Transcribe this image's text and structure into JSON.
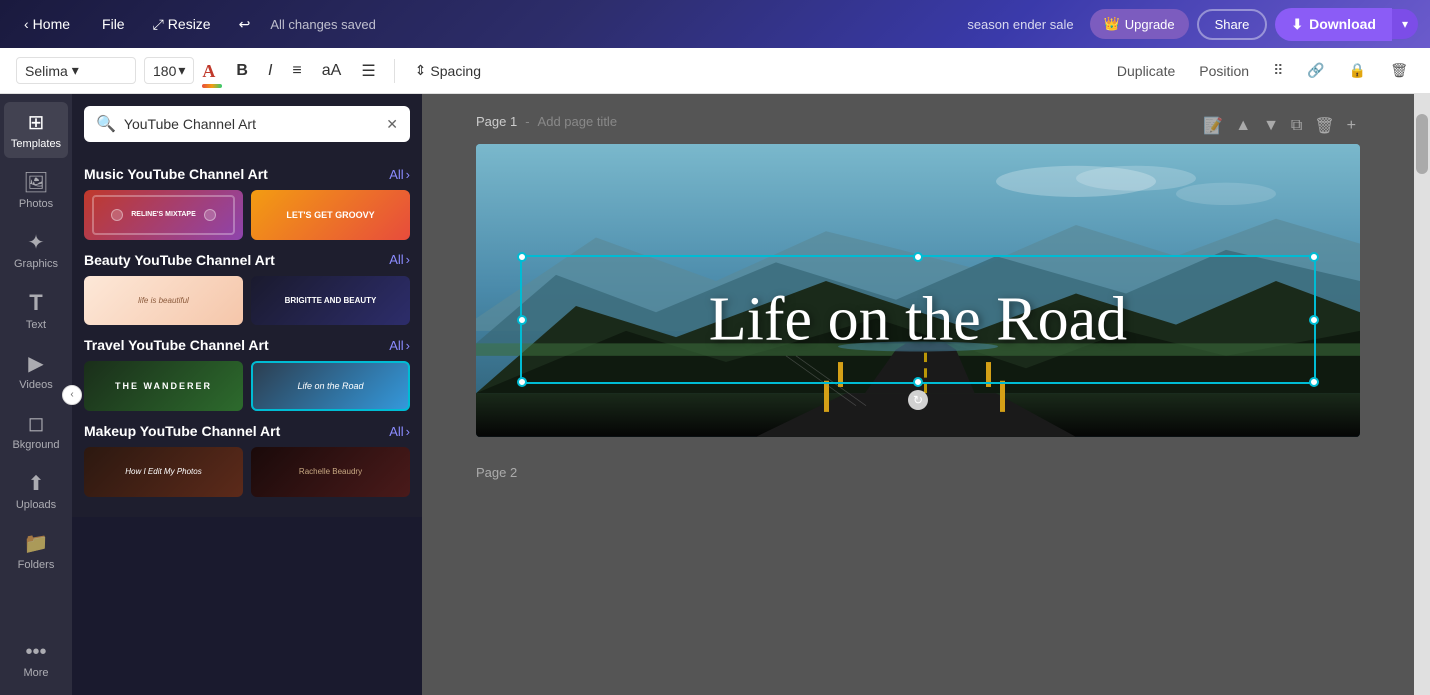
{
  "topnav": {
    "home_label": "Home",
    "file_label": "File",
    "resize_label": "Resize",
    "undo_icon": "↩",
    "changes_saved": "All changes saved",
    "sale_text": "season ender sale",
    "upgrade_label": "Upgrade",
    "upgrade_icon": "👑",
    "share_label": "Share",
    "download_label": "Download",
    "download_icon": "⬇"
  },
  "toolbar": {
    "font_name": "Selima",
    "font_size": "180",
    "bold_label": "B",
    "italic_label": "I",
    "align_icon": "≡",
    "case_icon": "aA",
    "spacing_label": "Spacing",
    "duplicate_label": "Duplicate",
    "position_label": "Position",
    "link_icon": "🔗",
    "lock_icon": "🔒",
    "trash_icon": "🗑"
  },
  "sidebar": {
    "items": [
      {
        "id": "templates",
        "label": "Templates",
        "icon": "⊞"
      },
      {
        "id": "photos",
        "label": "Photos",
        "icon": "🖼"
      },
      {
        "id": "graphics",
        "label": "Graphics",
        "icon": "✦"
      },
      {
        "id": "text",
        "label": "Text",
        "icon": "T"
      },
      {
        "id": "videos",
        "label": "Videos",
        "icon": "▶"
      },
      {
        "id": "background",
        "label": "Bkground",
        "icon": "◻"
      },
      {
        "id": "uploads",
        "label": "Uploads",
        "icon": "⬆"
      },
      {
        "id": "folders",
        "label": "Folders",
        "icon": "📁"
      },
      {
        "id": "more",
        "label": "More",
        "icon": "•••"
      }
    ]
  },
  "panel": {
    "search_value": "YouTube Channel Art",
    "search_placeholder": "YouTube Channel Art",
    "sections": [
      {
        "id": "music",
        "title": "Music YouTube Channel Art",
        "all_label": "All",
        "templates": [
          {
            "id": "music-1",
            "style": "tmpl-music-1",
            "text": "RELINE'S MIXTAPE"
          },
          {
            "id": "music-2",
            "style": "tmpl-music-2",
            "text": "LET'S GET GROOVY"
          }
        ]
      },
      {
        "id": "beauty",
        "title": "Beauty YouTube Channel Art",
        "all_label": "All",
        "templates": [
          {
            "id": "beauty-1",
            "style": "tmpl-beauty-1",
            "text": ""
          },
          {
            "id": "beauty-2",
            "style": "tmpl-beauty-2",
            "text": "BRIGITTE AND BEAUTY"
          }
        ]
      },
      {
        "id": "travel",
        "title": "Travel YouTube Channel Art",
        "all_label": "All",
        "templates": [
          {
            "id": "travel-1",
            "style": "tmpl-travel-1",
            "text": "THE WANDERER"
          },
          {
            "id": "travel-2",
            "style": "tmpl-travel-2",
            "text": "Life on the Road"
          }
        ]
      },
      {
        "id": "makeup",
        "title": "Makeup YouTube Channel Art",
        "all_label": "All",
        "templates": [
          {
            "id": "makeup-1",
            "style": "tmpl-makeup-1",
            "text": "How I Edit My Photos"
          },
          {
            "id": "makeup-2",
            "style": "tmpl-makeup-2",
            "text": "Rachelle Beaudry"
          }
        ]
      }
    ]
  },
  "canvas": {
    "page1_label": "Page 1",
    "page1_title_placeholder": "Add page title",
    "canvas_text": "Life on the Road",
    "page2_label": "Page 2"
  }
}
